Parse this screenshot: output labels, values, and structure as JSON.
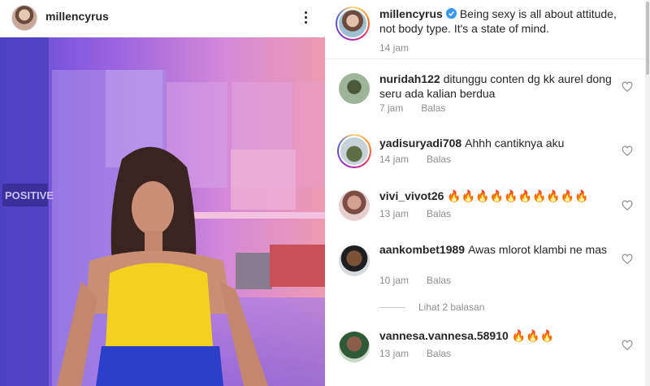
{
  "post": {
    "username": "millencyrus",
    "menu_icon": "more-vertical-icon"
  },
  "caption": {
    "username": "millencyrus",
    "verified": true,
    "text": "Being sexy is all about attitude, not body type. It's a state of mind.",
    "time": "14 jam"
  },
  "comments": [
    {
      "username": "nuridah122",
      "text": "ditunggu conten dg kk aurel dong seru ada kalian berdua",
      "time": "7 jam",
      "reply": "Balas"
    },
    {
      "username": "yadisuryadi708",
      "text": "Ahhh cantiknya aku",
      "time": "14 jam",
      "reply": "Balas"
    },
    {
      "username": "vivi_vivot26",
      "text": "🔥🔥🔥🔥🔥🔥🔥🔥🔥🔥",
      "time": "13 jam",
      "reply": "Balas"
    },
    {
      "username": "aankombet1989",
      "text": "Awas mlorot klambi ne mas",
      "time": "10 jam",
      "reply": "Balas"
    },
    {
      "username": "vannesa.vannesa.58910",
      "text": "🔥🔥🔥",
      "time": "13 jam",
      "reply": "Balas"
    }
  ],
  "view_replies": "Lihat 2 balasan",
  "colors": {
    "verified": "#3897f0",
    "meta": "#8e8e8e",
    "text": "#262626"
  }
}
